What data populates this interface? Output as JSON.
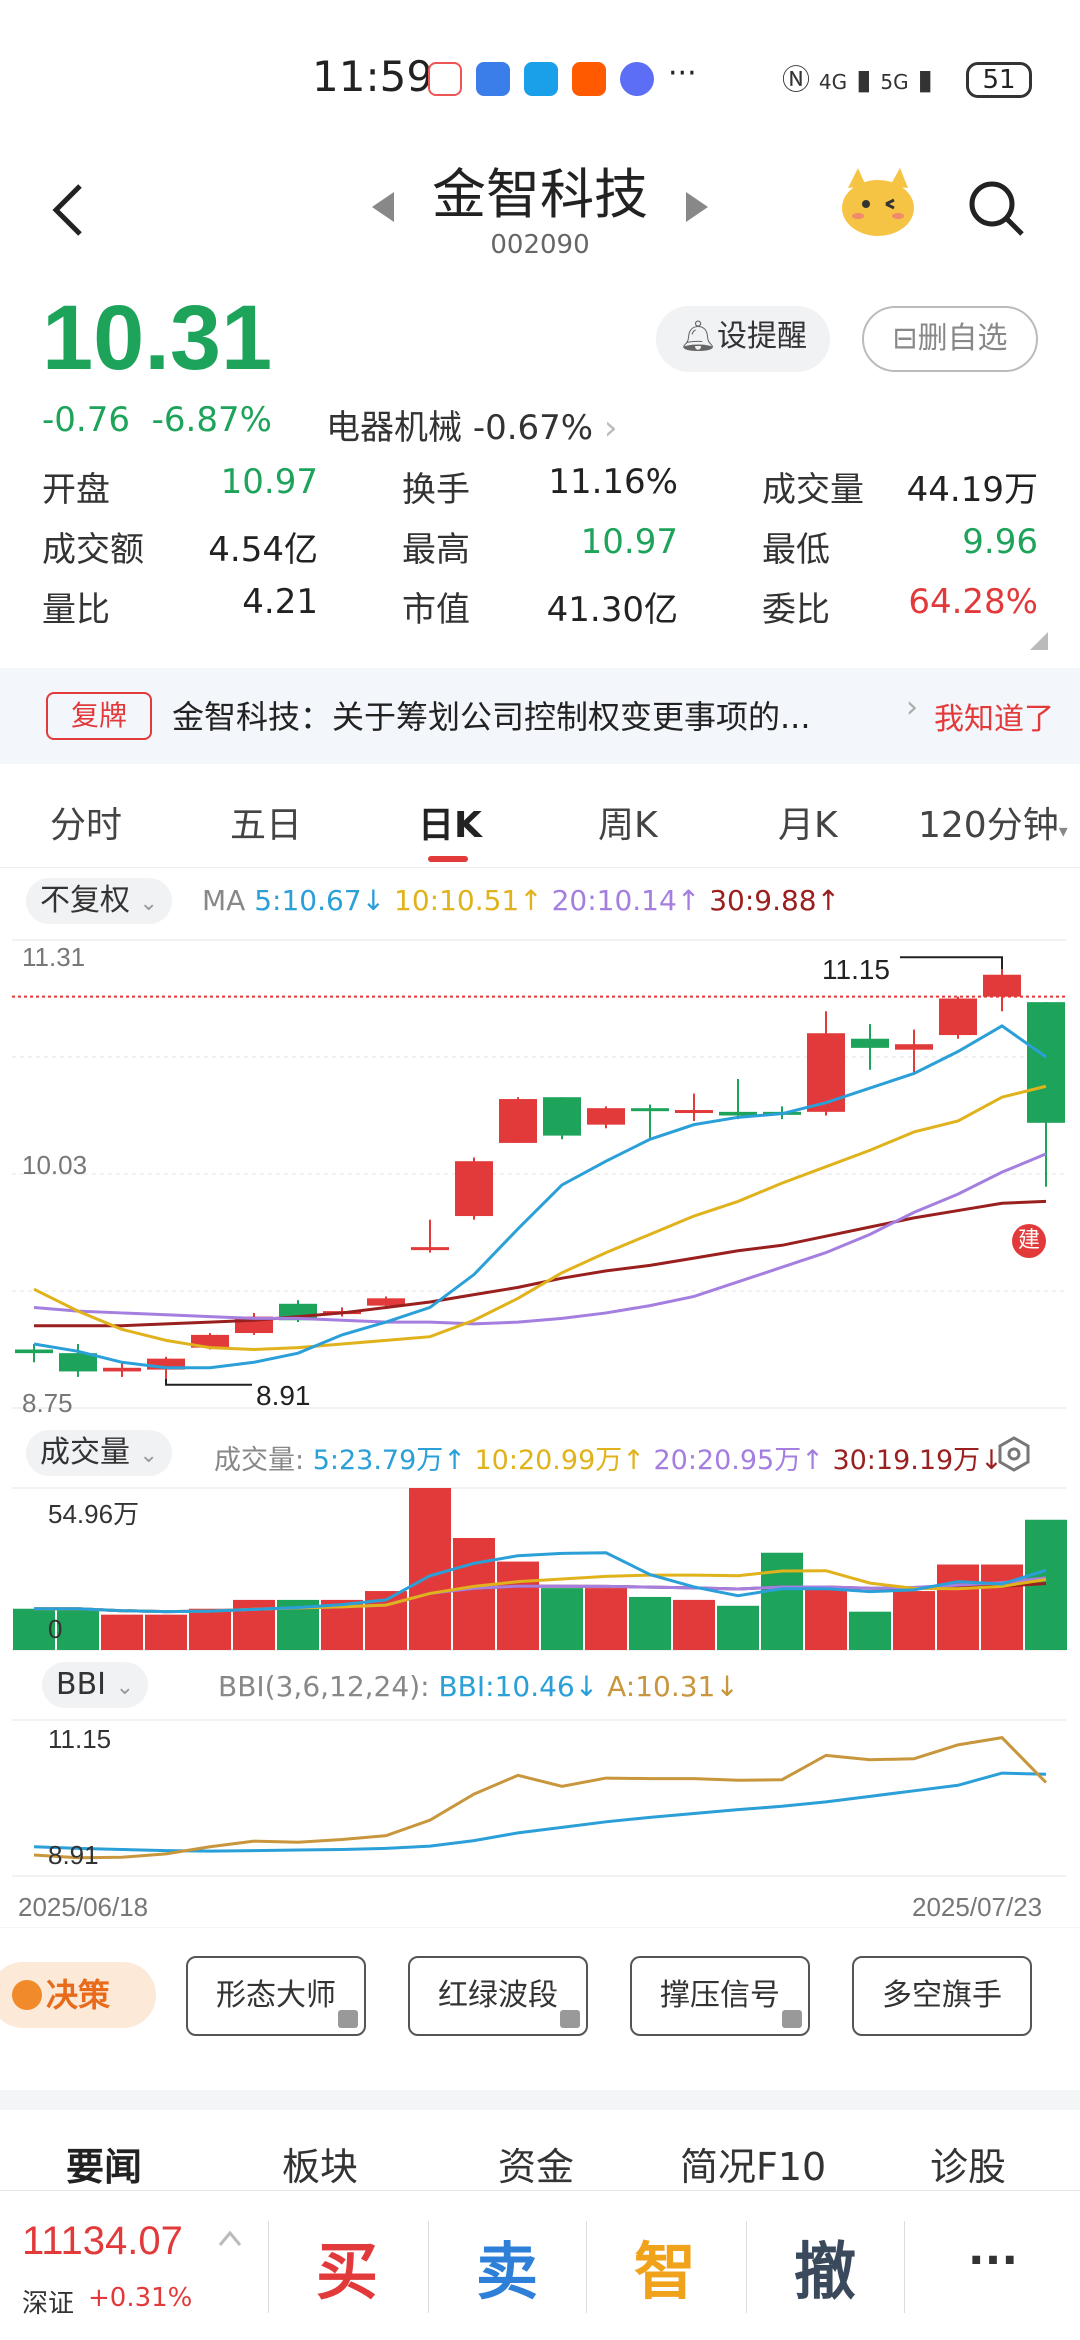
{
  "status_bar": {
    "time": "11:59",
    "net1": "4G",
    "net2": "5G",
    "battery": "51"
  },
  "header": {
    "name": "金智科技",
    "code": "002090"
  },
  "quote": {
    "price": "10.31",
    "change": "-0.76",
    "change_pct": "-6.87%",
    "sector": "电器机械",
    "sector_pct": "-0.67%",
    "alert_label": "设提醒",
    "watch_label": "删自选"
  },
  "stats": [
    {
      "label": "开盘",
      "value": "10.97",
      "color": "down"
    },
    {
      "label": "换手",
      "value": "11.16%",
      "color": "normal"
    },
    {
      "label": "成交量",
      "value": "44.19万",
      "color": "normal"
    },
    {
      "label": "成交额",
      "value": "4.54亿",
      "color": "normal"
    },
    {
      "label": "最高",
      "value": "10.97",
      "color": "down"
    },
    {
      "label": "最低",
      "value": "9.96",
      "color": "down"
    },
    {
      "label": "量比",
      "value": "4.21",
      "color": "normal"
    },
    {
      "label": "市值",
      "value": "41.30亿",
      "color": "normal"
    },
    {
      "label": "委比",
      "value": "64.28%",
      "color": "up"
    }
  ],
  "notice": {
    "tag": "复牌",
    "text": "金智科技：关于筹划公司控制权变更事项的...",
    "ack": "我知道了"
  },
  "tabs": [
    "分时",
    "五日",
    "日K",
    "周K",
    "月K",
    "120分钟"
  ],
  "kline": {
    "adjust_label": "不复权",
    "ma_prefix": "MA",
    "ma5": "5:10.67↓",
    "ma10": "10:10.51↑",
    "ma20": "20:10.14↑",
    "ma30": "30:9.88↑",
    "y_top": "11.31",
    "y_mid": "10.03",
    "y_bottom": "8.75",
    "high_mark": "11.15",
    "low_mark": "8.91",
    "build_badge": "建"
  },
  "volume": {
    "label": "成交量",
    "prefix": "成交量:",
    "ma5": "5:23.79万↑",
    "ma10": "10:20.99万↑",
    "ma20": "20:20.95万↑",
    "ma30": "30:19.19万↓",
    "y_top": "54.96万",
    "y_zero": "0"
  },
  "bbi": {
    "label": "BBI",
    "params": "BBI(3,6,12,24):",
    "bbi_val": "BBI:10.46↓",
    "a_val": "A:10.31↓",
    "y_top": "11.15",
    "y_bottom": "8.91",
    "date_start": "2025/06/18",
    "date_end": "2025/07/23"
  },
  "decision": {
    "tag": "决策",
    "tools": [
      "形态大师",
      "红绿波段",
      "撑压信号",
      "多空旗手"
    ]
  },
  "news_tabs": [
    "要闻",
    "板块",
    "资金",
    "简况F10",
    "诊股"
  ],
  "bottom": {
    "index_value": "11134.07",
    "index_name": "深证",
    "index_change": "+0.31%",
    "buy": "买",
    "sell": "卖",
    "smart": "智",
    "cancel": "撤",
    "more": "···"
  },
  "colors": {
    "up": "#e23a3a",
    "down": "#1ea35b",
    "ma5": "#2a9fd8",
    "ma10": "#e0b21c",
    "ma20": "#a47fe0",
    "ma30": "#9a1f1f"
  },
  "chart_data": {
    "type": "candlestick",
    "x_start": "2025/06/18",
    "x_end": "2025/07/23",
    "ylim": [
      8.75,
      11.31
    ],
    "candles": [
      {
        "o": 9.07,
        "c": 9.05,
        "h": 9.1,
        "l": 9.0
      },
      {
        "o": 9.05,
        "c": 8.95,
        "h": 9.1,
        "l": 8.92
      },
      {
        "o": 8.95,
        "c": 8.97,
        "h": 9.0,
        "l": 8.92
      },
      {
        "o": 8.96,
        "c": 9.02,
        "h": 9.03,
        "l": 8.91
      },
      {
        "o": 9.08,
        "c": 9.15,
        "h": 9.16,
        "l": 9.07
      },
      {
        "o": 9.16,
        "c": 9.25,
        "h": 9.27,
        "l": 9.15
      },
      {
        "o": 9.32,
        "c": 9.23,
        "h": 9.34,
        "l": 9.22
      },
      {
        "o": 9.27,
        "c": 9.28,
        "h": 9.3,
        "l": 9.25
      },
      {
        "o": 9.31,
        "c": 9.35,
        "h": 9.36,
        "l": 9.3
      },
      {
        "o": 9.62,
        "c": 9.63,
        "h": 9.78,
        "l": 9.6
      },
      {
        "o": 9.8,
        "c": 10.1,
        "h": 10.12,
        "l": 9.78
      },
      {
        "o": 10.2,
        "c": 10.44,
        "h": 10.45,
        "l": 10.2
      },
      {
        "o": 10.45,
        "c": 10.24,
        "h": 10.45,
        "l": 10.22
      },
      {
        "o": 10.3,
        "c": 10.39,
        "h": 10.4,
        "l": 10.28
      },
      {
        "o": 10.39,
        "c": 10.38,
        "h": 10.41,
        "l": 10.22
      },
      {
        "o": 10.37,
        "c": 10.38,
        "h": 10.47,
        "l": 10.32
      },
      {
        "o": 10.37,
        "c": 10.35,
        "h": 10.55,
        "l": 10.33
      },
      {
        "o": 10.37,
        "c": 10.36,
        "h": 10.4,
        "l": 10.33
      },
      {
        "o": 10.37,
        "c": 10.8,
        "h": 10.92,
        "l": 10.35
      },
      {
        "o": 10.77,
        "c": 10.72,
        "h": 10.85,
        "l": 10.6
      },
      {
        "o": 10.71,
        "c": 10.74,
        "h": 10.82,
        "l": 10.58
      },
      {
        "o": 10.79,
        "c": 10.99,
        "h": 11.0,
        "l": 10.77
      },
      {
        "o": 11.0,
        "c": 11.12,
        "h": 11.15,
        "l": 10.92
      },
      {
        "o": 10.97,
        "c": 10.31,
        "h": 10.97,
        "l": 9.96
      }
    ],
    "ma5": [
      9.1,
      9.06,
      9.0,
      8.97,
      8.97,
      9.0,
      9.05,
      9.15,
      9.22,
      9.3,
      9.48,
      9.73,
      9.97,
      10.1,
      10.22,
      10.3,
      10.34,
      10.36,
      10.42,
      10.5,
      10.58,
      10.7,
      10.84,
      10.67
    ],
    "ma10": [
      9.4,
      9.28,
      9.18,
      9.12,
      9.08,
      9.07,
      9.08,
      9.1,
      9.12,
      9.14,
      9.23,
      9.35,
      9.49,
      9.6,
      9.7,
      9.8,
      9.88,
      9.98,
      10.07,
      10.16,
      10.26,
      10.32,
      10.45,
      10.51
    ],
    "ma20": [
      9.3,
      9.28,
      9.27,
      9.26,
      9.25,
      9.24,
      9.24,
      9.23,
      9.22,
      9.22,
      9.21,
      9.22,
      9.24,
      9.27,
      9.31,
      9.36,
      9.44,
      9.52,
      9.6,
      9.7,
      9.82,
      9.92,
      10.04,
      10.14
    ],
    "ma30": [
      9.2,
      9.2,
      9.2,
      9.21,
      9.22,
      9.23,
      9.25,
      9.27,
      9.3,
      9.33,
      9.37,
      9.41,
      9.46,
      9.5,
      9.53,
      9.57,
      9.61,
      9.64,
      9.69,
      9.74,
      9.79,
      9.83,
      9.87,
      9.88
    ],
    "volume": [
      14,
      14,
      12,
      12,
      14,
      17,
      17,
      17,
      20,
      54.96,
      38,
      30,
      21,
      21,
      18,
      17,
      15,
      33,
      21,
      13,
      20,
      29,
      29,
      44.19
    ],
    "vol_ylim": [
      0,
      54.96
    ],
    "bbi_series": [
      9.15,
      9.12,
      9.1,
      9.08,
      9.07,
      9.08,
      9.09,
      9.1,
      9.12,
      9.16,
      9.26,
      9.4,
      9.5,
      9.6,
      9.68,
      9.75,
      9.82,
      9.88,
      9.96,
      10.06,
      10.16,
      10.26,
      10.48,
      10.46
    ],
    "a_series": [
      9.0,
      8.95,
      8.96,
      9.02,
      9.15,
      9.25,
      9.23,
      9.28,
      9.35,
      9.63,
      10.1,
      10.44,
      10.24,
      10.39,
      10.38,
      10.38,
      10.35,
      10.36,
      10.8,
      10.72,
      10.74,
      10.99,
      11.12,
      10.31
    ],
    "bbi_ylim": [
      8.91,
      11.15
    ]
  }
}
